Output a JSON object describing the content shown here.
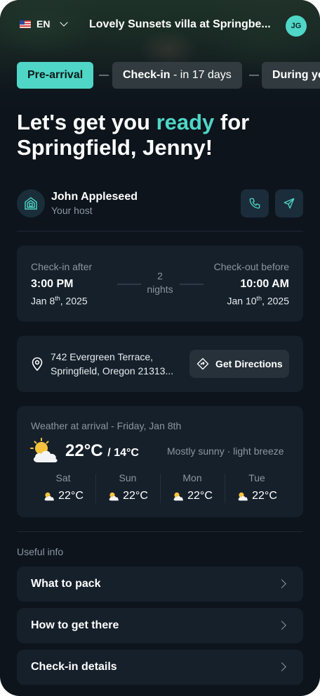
{
  "header": {
    "language": "EN",
    "property_name": "Lovely Sunsets villa at Springbe...",
    "avatar_initials": "JG"
  },
  "stepper": {
    "step1": "Pre-arrival",
    "step2_strong": "Check-in",
    "step2_suffix": " - in 17 days",
    "step3": "During yo"
  },
  "headline": {
    "part1": "Let's get you ",
    "accent": "ready",
    "part2": " for Springfield, Jenny!"
  },
  "host": {
    "name": "John Appleseed",
    "role": "Your host"
  },
  "stay": {
    "checkin_label": "Check-in after",
    "checkin_time": "3:00 PM",
    "checkin_date_day": "Jan 8",
    "checkin_date_suffix": "th",
    "checkin_date_year": ", 2025",
    "nights_count": "2",
    "nights_label": "nights",
    "checkout_label": "Check-out before",
    "checkout_time": "10:00 AM",
    "checkout_date_day": "Jan 10",
    "checkout_date_suffix": "th",
    "checkout_date_year": ", 2025"
  },
  "location": {
    "line1": "742 Evergreen Terrace,",
    "line2": "Springfield, Oregon 21313...",
    "directions_label": "Get Directions"
  },
  "weather": {
    "title": "Weather at arrival - Friday, Jan 8th",
    "high": "22°C",
    "low": "/ 14°C",
    "description": "Mostly sunny · light breeze",
    "forecast": [
      {
        "day": "Sat",
        "temp": "22°C"
      },
      {
        "day": "Sun",
        "temp": "22°C"
      },
      {
        "day": "Mon",
        "temp": "22°C"
      },
      {
        "day": "Tue",
        "temp": "22°C"
      }
    ]
  },
  "useful_info": {
    "heading": "Useful info",
    "items": [
      "What to pack",
      "How to get there",
      "Check-in details"
    ]
  },
  "colors": {
    "accent": "#4fd6c6",
    "background": "#0d141c",
    "card": "#16202b"
  },
  "icons": [
    "us-flag-icon",
    "chevron-down-icon",
    "house-icon",
    "phone-icon",
    "send-icon",
    "map-pin-icon",
    "directions-icon",
    "partly-sunny-icon",
    "chevron-right-icon"
  ]
}
